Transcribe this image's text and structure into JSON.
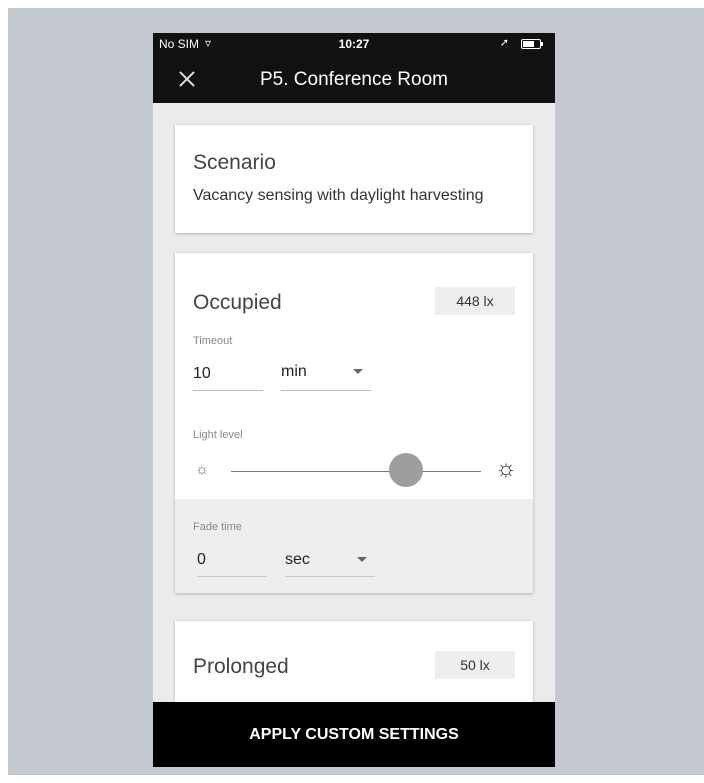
{
  "status_bar": {
    "carrier": "No SIM",
    "wifi_icon": "▿",
    "time": "10:27",
    "location_icon": "➚"
  },
  "app_bar": {
    "title": "P5. Conference Room"
  },
  "scenario": {
    "title": "Scenario",
    "description": "Vacancy sensing with daylight harvesting"
  },
  "occupied": {
    "title": "Occupied",
    "lux": "448 lx",
    "timeout_label": "Timeout",
    "timeout_value": "10",
    "timeout_unit": "min",
    "light_level_label": "Light level",
    "light_level_fraction": 0.7,
    "sun_small_icon": "☼",
    "sun_large_icon": "☼",
    "fade_label": "Fade time",
    "fade_value": "0",
    "fade_unit": "sec"
  },
  "prolonged": {
    "title": "Prolonged",
    "lux": "50 lx"
  },
  "footer": {
    "apply_label": "APPLY CUSTOM SETTINGS"
  }
}
